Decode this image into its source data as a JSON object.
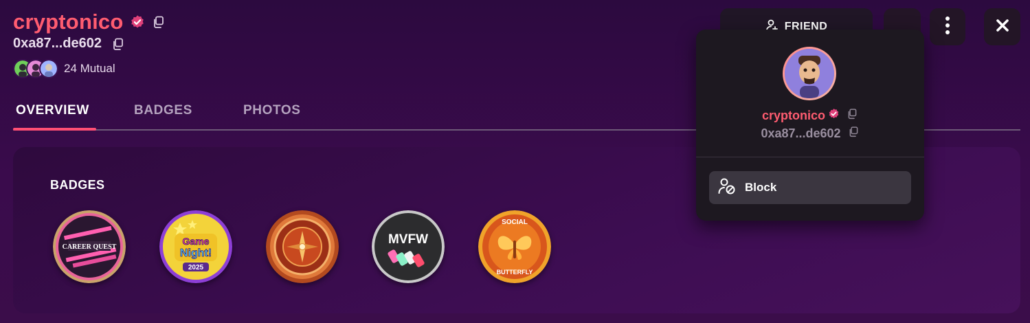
{
  "profile": {
    "username": "cryptonico",
    "address": "0xa87...de602",
    "mutual_label": "24 Mutual"
  },
  "tabs": [
    {
      "label": "OVERVIEW",
      "active": true
    },
    {
      "label": "BADGES",
      "active": false
    },
    {
      "label": "PHOTOS",
      "active": false
    }
  ],
  "badges_section": {
    "title": "BADGES",
    "badges": [
      {
        "icon": "career-quest-badge",
        "text_line1": "CAREER QUEST"
      },
      {
        "icon": "game-night-badge",
        "text_line1": "Game",
        "text_line2": "Night!",
        "text_line3": "2025"
      },
      {
        "icon": "compass-badge"
      },
      {
        "icon": "mvfw-badge",
        "text_line1": "MVFW"
      },
      {
        "icon": "social-butterfly-badge",
        "text_line1": "SOCIAL",
        "text_line2": "BUTTERFLY"
      }
    ]
  },
  "toolbar": {
    "friend_label": "FRIEND"
  },
  "popup": {
    "username": "cryptonico",
    "address": "0xa87...de602",
    "block_label": "Block"
  },
  "colors": {
    "accent": "#ff5c70",
    "verified": "#e0407a",
    "tab_underline": "#ff4f74",
    "background": "#2c0a3f"
  }
}
